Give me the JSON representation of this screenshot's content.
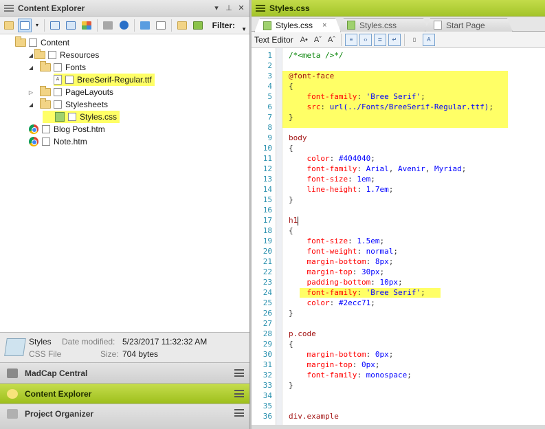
{
  "left_panel": {
    "title": "Content Explorer",
    "filter_label": "Filter:",
    "tree": [
      {
        "label": "Content",
        "icon": "folder-icon"
      },
      {
        "label": "Resources",
        "icon": "folder-icon"
      },
      {
        "label": "Fonts",
        "icon": "folder-icon"
      },
      {
        "label": "BreeSerif-Regular.ttf",
        "icon": "font-file-icon"
      },
      {
        "label": "PageLayouts",
        "icon": "folder-icon"
      },
      {
        "label": "Stylesheets",
        "icon": "folder-icon"
      },
      {
        "label": "Styles.css",
        "icon": "css-file-icon"
      },
      {
        "label": "Blog Post.htm",
        "icon": "chrome-icon"
      },
      {
        "label": "Note.htm",
        "icon": "chrome-icon"
      }
    ],
    "info": {
      "name": "Styles",
      "type": "CSS File",
      "date_label": "Date modified:",
      "date_value": "5/23/2017 11:32:32 AM",
      "size_label": "Size:",
      "size_value": "704 bytes"
    },
    "accordion": [
      "MadCap Central",
      "Content Explorer",
      "Project Organizer"
    ]
  },
  "right_panel": {
    "title": "Styles.css",
    "tabs": [
      "Styles.css",
      "Styles.css",
      "Start Page"
    ],
    "tab_close": "×",
    "editor_label": "Text Editor",
    "font_buttons": [
      "A•",
      "Aˇ",
      "Aˆ"
    ],
    "code_lines": [
      {
        "n": "1",
        "parts": [
          [
            "c-comment",
            "/*<meta />*/"
          ]
        ]
      },
      {
        "n": "2",
        "parts": []
      },
      {
        "n": "3",
        "parts": [
          [
            "c-sel",
            "@font-face"
          ]
        ]
      },
      {
        "n": "4",
        "parts": [
          [
            "c-brace",
            "{"
          ]
        ]
      },
      {
        "n": "5",
        "parts": [
          [
            "c-prop",
            "    font-family"
          ],
          [
            "c-brace",
            ": "
          ],
          [
            "c-val",
            "'Bree Serif'"
          ],
          [
            "c-brace",
            ";"
          ]
        ]
      },
      {
        "n": "6",
        "parts": [
          [
            "c-prop",
            "    src"
          ],
          [
            "c-brace",
            ": "
          ],
          [
            "c-val",
            "url(../Fonts/BreeSerif-Regular.ttf)"
          ],
          [
            "c-brace",
            ";"
          ]
        ]
      },
      {
        "n": "7",
        "parts": [
          [
            "c-brace",
            "}"
          ]
        ]
      },
      {
        "n": "8",
        "parts": []
      },
      {
        "n": "9",
        "parts": [
          [
            "c-sel",
            "body"
          ]
        ]
      },
      {
        "n": "10",
        "parts": [
          [
            "c-brace",
            "{"
          ]
        ]
      },
      {
        "n": "11",
        "parts": [
          [
            "c-prop",
            "    color"
          ],
          [
            "c-brace",
            ": "
          ],
          [
            "c-val",
            "#404040"
          ],
          [
            "c-brace",
            ";"
          ]
        ]
      },
      {
        "n": "12",
        "parts": [
          [
            "c-prop",
            "    font-family"
          ],
          [
            "c-brace",
            ": "
          ],
          [
            "c-val",
            "Arial"
          ],
          [
            "c-brace",
            ", "
          ],
          [
            "c-val",
            "Avenir"
          ],
          [
            "c-brace",
            ", "
          ],
          [
            "c-val",
            "Myriad"
          ],
          [
            "c-brace",
            ";"
          ]
        ]
      },
      {
        "n": "13",
        "parts": [
          [
            "c-prop",
            "    font-size"
          ],
          [
            "c-brace",
            ": "
          ],
          [
            "c-val",
            "1em"
          ],
          [
            "c-brace",
            ";"
          ]
        ]
      },
      {
        "n": "14",
        "parts": [
          [
            "c-prop",
            "    line-height"
          ],
          [
            "c-brace",
            ": "
          ],
          [
            "c-val",
            "1.7em"
          ],
          [
            "c-brace",
            ";"
          ]
        ]
      },
      {
        "n": "15",
        "parts": [
          [
            "c-brace",
            "}"
          ]
        ]
      },
      {
        "n": "16",
        "parts": []
      },
      {
        "n": "17",
        "parts": [
          [
            "c-sel",
            "h1"
          ]
        ],
        "caret": true
      },
      {
        "n": "18",
        "parts": [
          [
            "c-brace",
            "{"
          ]
        ]
      },
      {
        "n": "19",
        "parts": [
          [
            "c-prop",
            "    font-size"
          ],
          [
            "c-brace",
            ": "
          ],
          [
            "c-val",
            "1.5em"
          ],
          [
            "c-brace",
            ";"
          ]
        ]
      },
      {
        "n": "20",
        "parts": [
          [
            "c-prop",
            "    font-weight"
          ],
          [
            "c-brace",
            ": "
          ],
          [
            "c-val",
            "normal"
          ],
          [
            "c-brace",
            ";"
          ]
        ]
      },
      {
        "n": "21",
        "parts": [
          [
            "c-prop",
            "    margin-bottom"
          ],
          [
            "c-brace",
            ": "
          ],
          [
            "c-val",
            "8px"
          ],
          [
            "c-brace",
            ";"
          ]
        ]
      },
      {
        "n": "22",
        "parts": [
          [
            "c-prop",
            "    margin-top"
          ],
          [
            "c-brace",
            ": "
          ],
          [
            "c-val",
            "30px"
          ],
          [
            "c-brace",
            ";"
          ]
        ]
      },
      {
        "n": "23",
        "parts": [
          [
            "c-prop",
            "    padding-bottom"
          ],
          [
            "c-brace",
            ": "
          ],
          [
            "c-val",
            "10px"
          ],
          [
            "c-brace",
            ";"
          ]
        ]
      },
      {
        "n": "24",
        "parts": [
          [
            "c-prop",
            "    font-family"
          ],
          [
            "c-brace",
            ": "
          ],
          [
            "c-val",
            "'Bree Serif'"
          ],
          [
            "c-brace",
            ";"
          ]
        ]
      },
      {
        "n": "25",
        "parts": [
          [
            "c-prop",
            "    color"
          ],
          [
            "c-brace",
            ": "
          ],
          [
            "c-val",
            "#2ecc71"
          ],
          [
            "c-brace",
            ";"
          ]
        ]
      },
      {
        "n": "26",
        "parts": [
          [
            "c-brace",
            "}"
          ]
        ]
      },
      {
        "n": "27",
        "parts": []
      },
      {
        "n": "28",
        "parts": [
          [
            "c-sel",
            "p.code"
          ]
        ]
      },
      {
        "n": "29",
        "parts": [
          [
            "c-brace",
            "{"
          ]
        ]
      },
      {
        "n": "30",
        "parts": [
          [
            "c-prop",
            "    margin-bottom"
          ],
          [
            "c-brace",
            ": "
          ],
          [
            "c-val",
            "0px"
          ],
          [
            "c-brace",
            ";"
          ]
        ]
      },
      {
        "n": "31",
        "parts": [
          [
            "c-prop",
            "    margin-top"
          ],
          [
            "c-brace",
            ": "
          ],
          [
            "c-val",
            "0px"
          ],
          [
            "c-brace",
            ";"
          ]
        ]
      },
      {
        "n": "32",
        "parts": [
          [
            "c-prop",
            "    font-family"
          ],
          [
            "c-brace",
            ": "
          ],
          [
            "c-val",
            "monospace"
          ],
          [
            "c-brace",
            ";"
          ]
        ]
      },
      {
        "n": "33",
        "parts": [
          [
            "c-brace",
            "}"
          ]
        ]
      },
      {
        "n": "34",
        "parts": []
      },
      {
        "n": "35",
        "parts": []
      },
      {
        "n": "36",
        "parts": [
          [
            "c-sel",
            "div.example"
          ]
        ]
      }
    ]
  },
  "colors": {
    "highlight": "#ffff66",
    "accent_green": "#a4c42a",
    "line_number": "#2b91af"
  }
}
